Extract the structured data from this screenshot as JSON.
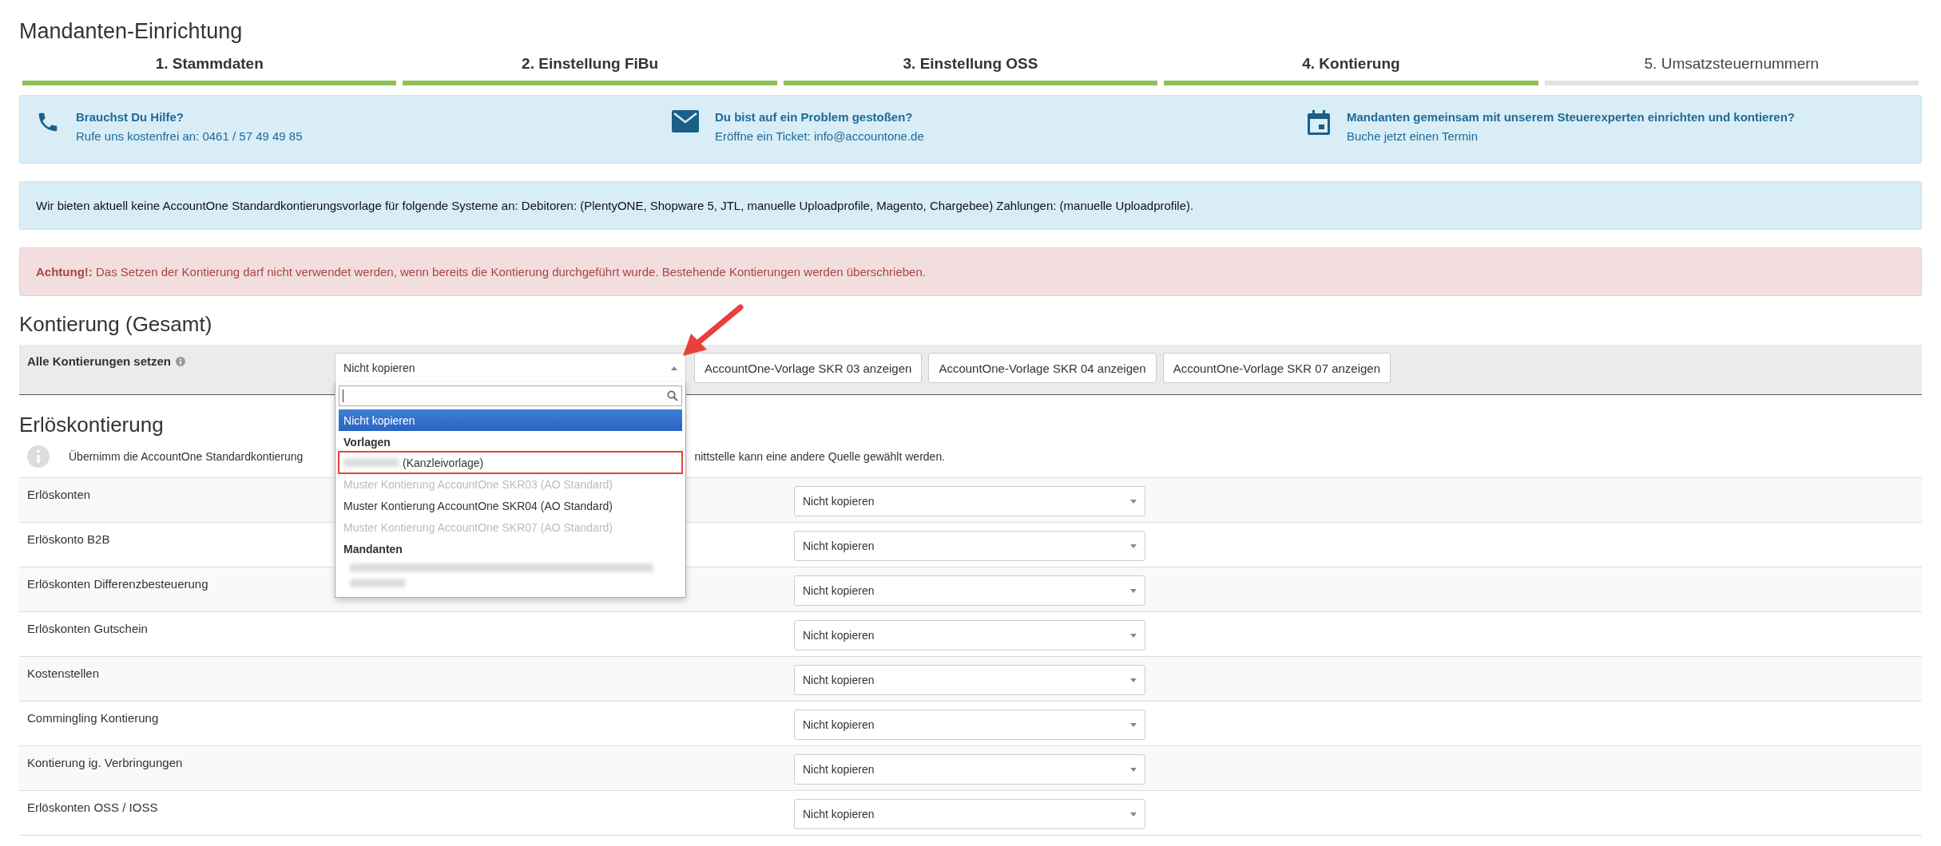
{
  "page_title": "Mandanten-Einrichtung",
  "steps": [
    {
      "label": "1. Stammdaten",
      "completed": true
    },
    {
      "label": "2. Einstellung FiBu",
      "completed": true
    },
    {
      "label": "3. Einstellung OSS",
      "completed": true
    },
    {
      "label": "4. Kontierung",
      "completed": true
    },
    {
      "label": "5. Umsatzsteuernummern",
      "completed": false
    }
  ],
  "help_bar": [
    {
      "kind": "phone",
      "title": "Brauchst Du Hilfe?",
      "text": "Rufe uns kostenfrei an: 0461 / 57 49 49 85"
    },
    {
      "kind": "mail",
      "title": "Du bist auf ein Problem gestoßen?",
      "text": "Eröffne ein Ticket: info@accountone.de"
    },
    {
      "kind": "calendar",
      "title": "Mandanten gemeinsam mit unserem Steuerexperten einrichten und kontieren?",
      "text": "Buche jetzt einen Termin"
    }
  ],
  "info_notice": "Wir bieten aktuell keine AccountOne Standardkontierungsvorlage für folgende Systeme an: Debitoren: (PlentyONE, Shopware 5, JTL, manuelle Uploadprofile, Magento, Chargebee) Zahlungen: (manuelle Uploadprofile).",
  "warning_notice": "**Achtung!:** Das Setzen der Kontierung darf nicht verwendet werden, wenn bereits die Kontierung durchgeführt wurde. Bestehende Kontierungen werden überschrieben.",
  "overall_section": {
    "heading": "Kontierung (Gesamt)",
    "label": "Alle Kontierungen setzen",
    "select_value": "Nicht kopieren",
    "expanded": true,
    "buttons": [
      "AccountOne-Vorlage SKR 03 anzeigen",
      "AccountOne-Vorlage SKR 04 anzeigen",
      "AccountOne-Vorlage SKR 07 anzeigen"
    ],
    "dropdown": {
      "options": [
        {
          "kind": "option",
          "label": "Nicht kopieren",
          "selected": true,
          "disabled": false,
          "redacted": false,
          "highlighted": false
        },
        {
          "kind": "group",
          "label": "Vorlagen"
        },
        {
          "kind": "option",
          "label": "(Kanzleivorlage)",
          "selected": false,
          "disabled": false,
          "redacted": true,
          "highlighted": true
        },
        {
          "kind": "option",
          "label": "Muster Kontierung AccountOne SKR03 (AO Standard)",
          "selected": false,
          "disabled": true,
          "redacted": false,
          "highlighted": false
        },
        {
          "kind": "option",
          "label": "Muster Kontierung AccountOne SKR04 (AO Standard)",
          "selected": false,
          "disabled": false,
          "redacted": false,
          "highlighted": false
        },
        {
          "kind": "option",
          "label": "Muster Kontierung AccountOne SKR07 (AO Standard)",
          "selected": false,
          "disabled": true,
          "redacted": false,
          "highlighted": false
        },
        {
          "kind": "group",
          "label": "Mandanten"
        },
        {
          "kind": "blurred"
        }
      ]
    }
  },
  "revenue_section": {
    "heading": "Erlöskontierung",
    "hint_before": "Übernimm die AccountOne Standardkontierung",
    "hint_after": "nittstelle kann eine andere Quelle gewählt werden.",
    "rows": [
      {
        "label": "Erlöskonten",
        "value": "Nicht kopieren"
      },
      {
        "label": "Erlöskonto B2B",
        "value": "Nicht kopieren"
      },
      {
        "label": "Erlöskonten Differenzbesteuerung",
        "value": "Nicht kopieren"
      },
      {
        "label": "Erlöskonten Gutschein",
        "value": "Nicht kopieren"
      },
      {
        "label": "Kostenstellen",
        "value": "Nicht kopieren"
      },
      {
        "label": "Commingling Kontierung",
        "value": "Nicht kopieren"
      },
      {
        "label": "Kontierung ig. Verbringungen",
        "value": "Nicht kopieren"
      },
      {
        "label": "Erlöskonten OSS / IOSS",
        "value": "Nicht kopieren"
      }
    ]
  }
}
